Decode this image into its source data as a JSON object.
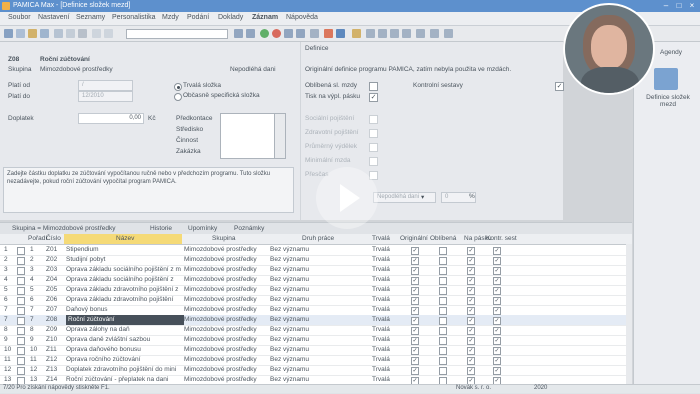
{
  "window": {
    "title": "PAMICA Max - [Definice složek mezd]"
  },
  "menu": [
    "Soubor",
    "Nastavení",
    "Seznamy",
    "Personalistika",
    "Mzdy",
    "Podání",
    "Doklady",
    "Záznam",
    "Nápověda"
  ],
  "form": {
    "code": "Z08",
    "name": "Roční zúčtování",
    "skupina_label": "Skupina",
    "skupina_value": "Mimozdobové prostředky",
    "nepodlehá_dani": "Nepodléhá dani",
    "plati_od_label": "Platí od",
    "plati_od_value": "/",
    "plati_do_label": "Platí do",
    "plati_do_value": "12/2010",
    "radio_trvala": "Trvalá složka",
    "radio_obcasna": "Občasně specifická složka",
    "doplatek_label": "Doplatek",
    "doplatek_value": "0,00",
    "doplatek_unit": "Kč",
    "predkontace": "Předkontace",
    "stredisko": "Středisko",
    "cinnost": "Činnost",
    "zakazka": "Zakázka",
    "note": "Zadejte částku doplatku ze zúčtování vypočítanou ručně nebo v předchozím programu. Tuto složku nezadávejte, pokud roční zúčtování vypočítal program PAMICA."
  },
  "definice": {
    "heading": "Definice",
    "info": "Originální definice programu PAMICA, zatím nebyla použita ve mzdách.",
    "oblibena": "Oblíbená sl. mzdy",
    "kontrolni": "Kontrolní sestavy",
    "tisk": "Tisk na výpl. pásku",
    "socialni": "Sociální pojištění",
    "zdravotni": "Zdravotní pojištění",
    "prumerny": "Průměrný výdělek",
    "minimalni": "Minimální mzda",
    "prescas": "Přesčas",
    "dane_value": "Nepodléhá dani",
    "zero": "0",
    "percent": "%"
  },
  "sidebar": {
    "title": "Agendy",
    "item": "Definice složek mezd"
  },
  "tabs": [
    "Skupina = Mimozdobové prostředky",
    "Historie",
    "Upomínky",
    "Poznámky"
  ],
  "grid": {
    "columns": [
      "Pořadí",
      "Číslo",
      "Název",
      "Skupina",
      "Druh práce",
      "Trvalá",
      "Originální",
      "Oblíbená",
      "Na pásku",
      "Kontr. sest"
    ],
    "rows": [
      {
        "n": "1",
        "por": "1",
        "code": "Z01",
        "name": "Stipendium",
        "group": "Mimozdobové prostředky",
        "druh": "Bez významu",
        "trvala": "Trvalá",
        "orig": "✓",
        "obl": "",
        "pas": "✓",
        "kontr": "✓"
      },
      {
        "n": "2",
        "por": "2",
        "code": "Z02",
        "name": "Studijní pobyt",
        "group": "Mimozdobové prostředky",
        "druh": "Bez významu",
        "trvala": "Trvalá",
        "orig": "✓",
        "obl": "",
        "pas": "✓",
        "kontr": "✓"
      },
      {
        "n": "3",
        "por": "3",
        "code": "Z03",
        "name": "Oprava základu sociálního pojištění z m",
        "group": "Mimozdobové prostředky",
        "druh": "Bez významu",
        "trvala": "Trvalá",
        "orig": "✓",
        "obl": "",
        "pas": "✓",
        "kontr": "✓"
      },
      {
        "n": "4",
        "por": "4",
        "code": "Z04",
        "name": "Oprava základu sociálního pojištění z",
        "group": "Mimozdobové prostředky",
        "druh": "Bez významu",
        "trvala": "Trvalá",
        "orig": "✓",
        "obl": "",
        "pas": "✓",
        "kontr": "✓"
      },
      {
        "n": "5",
        "por": "5",
        "code": "Z05",
        "name": "Oprava základu zdravotního pojištění z",
        "group": "Mimozdobové prostředky",
        "druh": "Bez významu",
        "trvala": "Trvalá",
        "orig": "✓",
        "obl": "",
        "pas": "✓",
        "kontr": "✓"
      },
      {
        "n": "6",
        "por": "6",
        "code": "Z06",
        "name": "Oprava základu zdravotního pojištění",
        "group": "Mimozdobové prostředky",
        "druh": "Bez významu",
        "trvala": "Trvalá",
        "orig": "✓",
        "obl": "",
        "pas": "✓",
        "kontr": "✓"
      },
      {
        "n": "7",
        "por": "7",
        "code": "Z07",
        "name": "Daňový bonus",
        "group": "Mimozdobové prostředky",
        "druh": "Bez významu",
        "trvala": "Trvalá",
        "orig": "✓",
        "obl": "",
        "pas": "✓",
        "kontr": "✓"
      },
      {
        "n": "7",
        "por": "7",
        "code": "Z08",
        "name": "Roční zúčtování",
        "group": "Mimozdobové prostředky",
        "druh": "Bez významu",
        "trvala": "Trvalá",
        "orig": "✓",
        "obl": "",
        "pas": "✓",
        "kontr": "✓",
        "selected": true
      },
      {
        "n": "8",
        "por": "8",
        "code": "Z09",
        "name": "Oprava zálohy na daň",
        "group": "Mimozdobové prostředky",
        "druh": "Bez významu",
        "trvala": "Trvalá",
        "orig": "✓",
        "obl": "",
        "pas": "✓",
        "kontr": "✓"
      },
      {
        "n": "9",
        "por": "9",
        "code": "Z10",
        "name": "Oprava daně zvláštní sazbou",
        "group": "Mimozdobové prostředky",
        "druh": "Bez významu",
        "trvala": "Trvalá",
        "orig": "✓",
        "obl": "",
        "pas": "✓",
        "kontr": "✓"
      },
      {
        "n": "10",
        "por": "10",
        "code": "Z11",
        "name": "Oprava daňového bonusu",
        "group": "Mimozdobové prostředky",
        "druh": "Bez významu",
        "trvala": "Trvalá",
        "orig": "✓",
        "obl": "",
        "pas": "✓",
        "kontr": "✓"
      },
      {
        "n": "11",
        "por": "11",
        "code": "Z12",
        "name": "Oprava ročního zúčtování",
        "group": "Mimozdobové prostředky",
        "druh": "Bez významu",
        "trvala": "Trvalá",
        "orig": "✓",
        "obl": "",
        "pas": "✓",
        "kontr": "✓"
      },
      {
        "n": "12",
        "por": "12",
        "code": "Z13",
        "name": "Doplatek zdravotního pojištění do mini",
        "group": "Mimozdobové prostředky",
        "druh": "Bez významu",
        "trvala": "Trvalá",
        "orig": "✓",
        "obl": "",
        "pas": "✓",
        "kontr": "✓"
      },
      {
        "n": "13",
        "por": "13",
        "code": "Z14",
        "name": "Roční zúčtování - přeplatek na dani",
        "group": "Mimozdobové prostředky",
        "druh": "Bez významu",
        "trvala": "Trvalá",
        "orig": "✓",
        "obl": "",
        "pas": "✓",
        "kontr": "✓"
      }
    ]
  },
  "status": {
    "left": "7/20 Pro získání nápovědy stiskněte F1.",
    "company": "Novák s. r. o.",
    "year": "2020"
  },
  "colors": {
    "titlebar": "#3a78c2",
    "selection": "#dfe7f3",
    "yellow_header": "#f3d25a"
  }
}
